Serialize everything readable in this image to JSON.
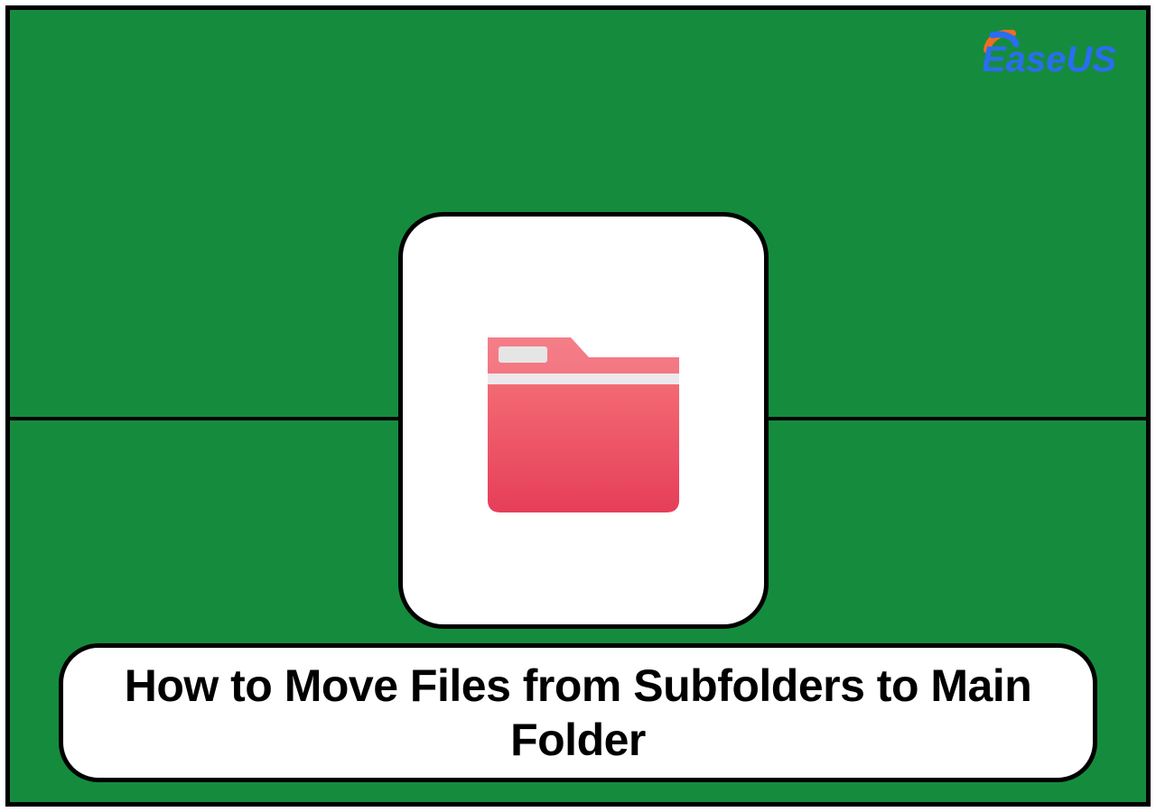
{
  "brand": {
    "name": "EaseUS"
  },
  "title": "How to Move Files from Subfolders to Main Folder",
  "icon": {
    "semantic": "folder-icon",
    "color_top": "#f36a73",
    "color_bottom": "#e63e59",
    "tab_color": "#e5e5e5"
  },
  "colors": {
    "background": "#158c3d",
    "card": "#ffffff",
    "border": "#000000",
    "brand_blue": "#2a6df0",
    "brand_orange": "#f36c1d"
  }
}
